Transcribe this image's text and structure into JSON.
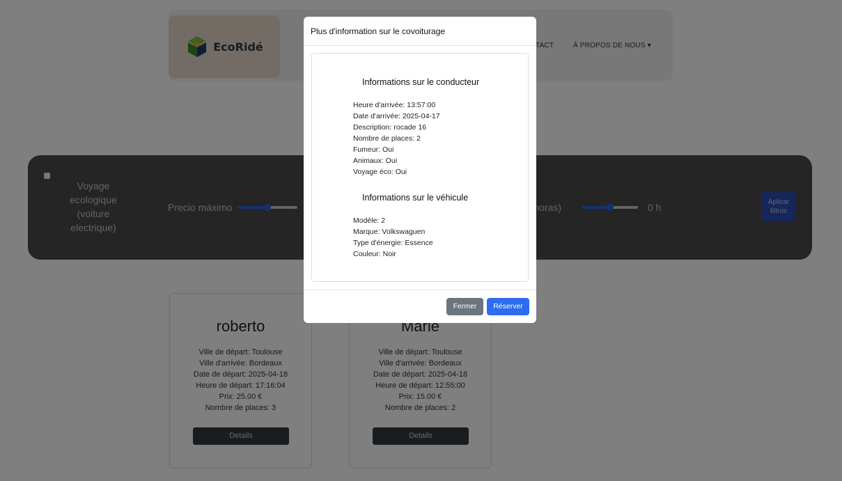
{
  "header": {
    "logo_text": "EcoRidé",
    "nav_contact": "TACT",
    "nav_about": "À PROPOS DE NOUS ▾"
  },
  "filters": {
    "voyage_lines": [
      "Voyage",
      "ecologique",
      "(voiture",
      "electrique)"
    ],
    "precio_label": "Precio máximo",
    "precio_value": 0.5,
    "duree_label": "a (horas)",
    "duree_value": 0.5,
    "hours_value": "0 h",
    "apply_lines": [
      "Aplicar",
      "filtros"
    ]
  },
  "cards": [
    {
      "name": "roberto",
      "lines": [
        "Ville de départ: Toulouse",
        "Ville d'arrivée: Bordeaux",
        "Date de départ: 2025-04-18",
        "Heure de départ: 17:16:04",
        "Prix: 25.00 €",
        "Nombre de places: 3"
      ],
      "button": "Details"
    },
    {
      "name": "Marie",
      "lines": [
        "Ville de départ: Toulouse",
        "Ville d'arrivée: Bordeaux",
        "Date de départ: 2025-04-18",
        "Heure de départ: 12:55:00",
        "Prix: 15.00 €",
        "Nombre de places: 2"
      ],
      "button": "Details"
    }
  ],
  "modal": {
    "title": "Plus d'information sur le covoiturage",
    "driver_title": "Informations sur le conducteur",
    "driver_lines": [
      "Heure d'arrivée: 13:57:00",
      "Date d'arrivée: 2025-04-17",
      "Description: rocade 16",
      "Nombre de places: 2",
      "Fumeur: Oui",
      "Animaux: Oui",
      "Voyage éco: Oui"
    ],
    "vehicle_title": "Informations sur le véhicule",
    "vehicle_lines": [
      "Modèle: 2",
      "Marque: Volkswaguen",
      "Type d'énergie: Essence",
      "Couleur: Noir"
    ],
    "close_label": "Fermer",
    "reserve_label": "Réserver"
  },
  "colors": {
    "primary": "#2d6cf0",
    "secondary": "#6c757d",
    "dark": "#333a42"
  }
}
